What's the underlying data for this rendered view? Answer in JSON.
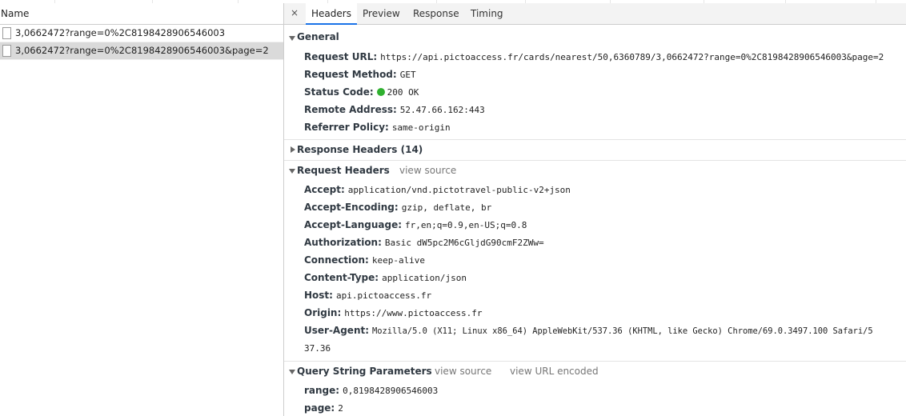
{
  "left": {
    "header": "Name",
    "requests": [
      {
        "label": "3,0662472?range=0%2C8198428906546003",
        "selected": false
      },
      {
        "label": "3,0662472?range=0%2C8198428906546003&page=2",
        "selected": true
      }
    ]
  },
  "tabs": {
    "close": "×",
    "items": [
      "Headers",
      "Preview",
      "Response",
      "Timing"
    ],
    "active": "Headers"
  },
  "general": {
    "title": "General",
    "rows": [
      {
        "k": "Request URL:",
        "v": "https://api.pictoaccess.fr/cards/nearest/50,6360789/3,0662472?range=0%2C8198428906546003&page=2"
      },
      {
        "k": "Request Method:",
        "v": "GET"
      },
      {
        "k": "Status Code:",
        "v": "200 OK"
      },
      {
        "k": "Remote Address:",
        "v": "52.47.66.162:443"
      },
      {
        "k": "Referrer Policy:",
        "v": "same-origin"
      }
    ]
  },
  "response_headers": {
    "title": "Response Headers (14)"
  },
  "request_headers": {
    "title": "Request Headers",
    "view_source": "view source",
    "rows": [
      {
        "k": "Accept:",
        "v": "application/vnd.pictotravel-public-v2+json"
      },
      {
        "k": "Accept-Encoding:",
        "v": "gzip, deflate, br"
      },
      {
        "k": "Accept-Language:",
        "v": "fr,en;q=0.9,en-US;q=0.8"
      },
      {
        "k": "Authorization:",
        "v": "Basic dW5pc2M6cGljdG90cmF2ZWw="
      },
      {
        "k": "Connection:",
        "v": "keep-alive"
      },
      {
        "k": "Content-Type:",
        "v": "application/json"
      },
      {
        "k": "Host:",
        "v": "api.pictoaccess.fr"
      },
      {
        "k": "Origin:",
        "v": "https://www.pictoaccess.fr"
      },
      {
        "k": "User-Agent:",
        "v": "Mozilla/5.0 (X11; Linux x86_64) AppleWebKit/537.36 (KHTML, like Gecko) Chrome/69.0.3497.100 Safari/5",
        "cont": "37.36"
      }
    ]
  },
  "query_params": {
    "title": "Query String Parameters",
    "view_source": "view source",
    "view_url_encoded": "view URL encoded",
    "rows": [
      {
        "k": "range:",
        "v": "0,8198428906546003"
      },
      {
        "k": "page:",
        "v": "2"
      }
    ]
  },
  "colors": {
    "status_ok": "#2fb02f",
    "active_tab": "#1a73e8",
    "selected_row": "#dadada"
  }
}
